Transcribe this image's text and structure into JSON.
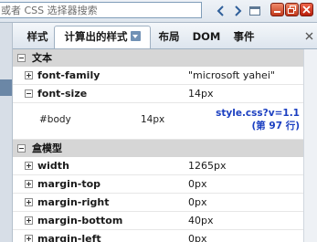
{
  "toolbar": {
    "search_placeholder": "或者 CSS 选择器搜索"
  },
  "tabs": [
    {
      "label": "样式"
    },
    {
      "label": "计算出的样式"
    },
    {
      "label": "布局"
    },
    {
      "label": "DOM"
    },
    {
      "label": "事件"
    }
  ],
  "sections": {
    "text": {
      "label": "文本",
      "rows": [
        {
          "name": "font-family",
          "value": "\"microsoft yahei\""
        },
        {
          "name": "font-size",
          "value": "14px"
        }
      ],
      "detail": {
        "selector": "#body",
        "value": "14px",
        "source_file": "style.css?v=1.1",
        "source_line": "(第 97 行)"
      }
    },
    "box_model": {
      "label": "盒模型",
      "rows": [
        {
          "name": "width",
          "value": "1265px"
        },
        {
          "name": "margin-top",
          "value": "0px"
        },
        {
          "name": "margin-right",
          "value": "0px"
        },
        {
          "name": "margin-bottom",
          "value": "40px"
        },
        {
          "name": "margin-left",
          "value": "0px"
        }
      ]
    }
  },
  "colors": {
    "link_blue": "#1b3fc1",
    "section_gray": "#d6d6d6",
    "close_red": "#c2391c"
  }
}
